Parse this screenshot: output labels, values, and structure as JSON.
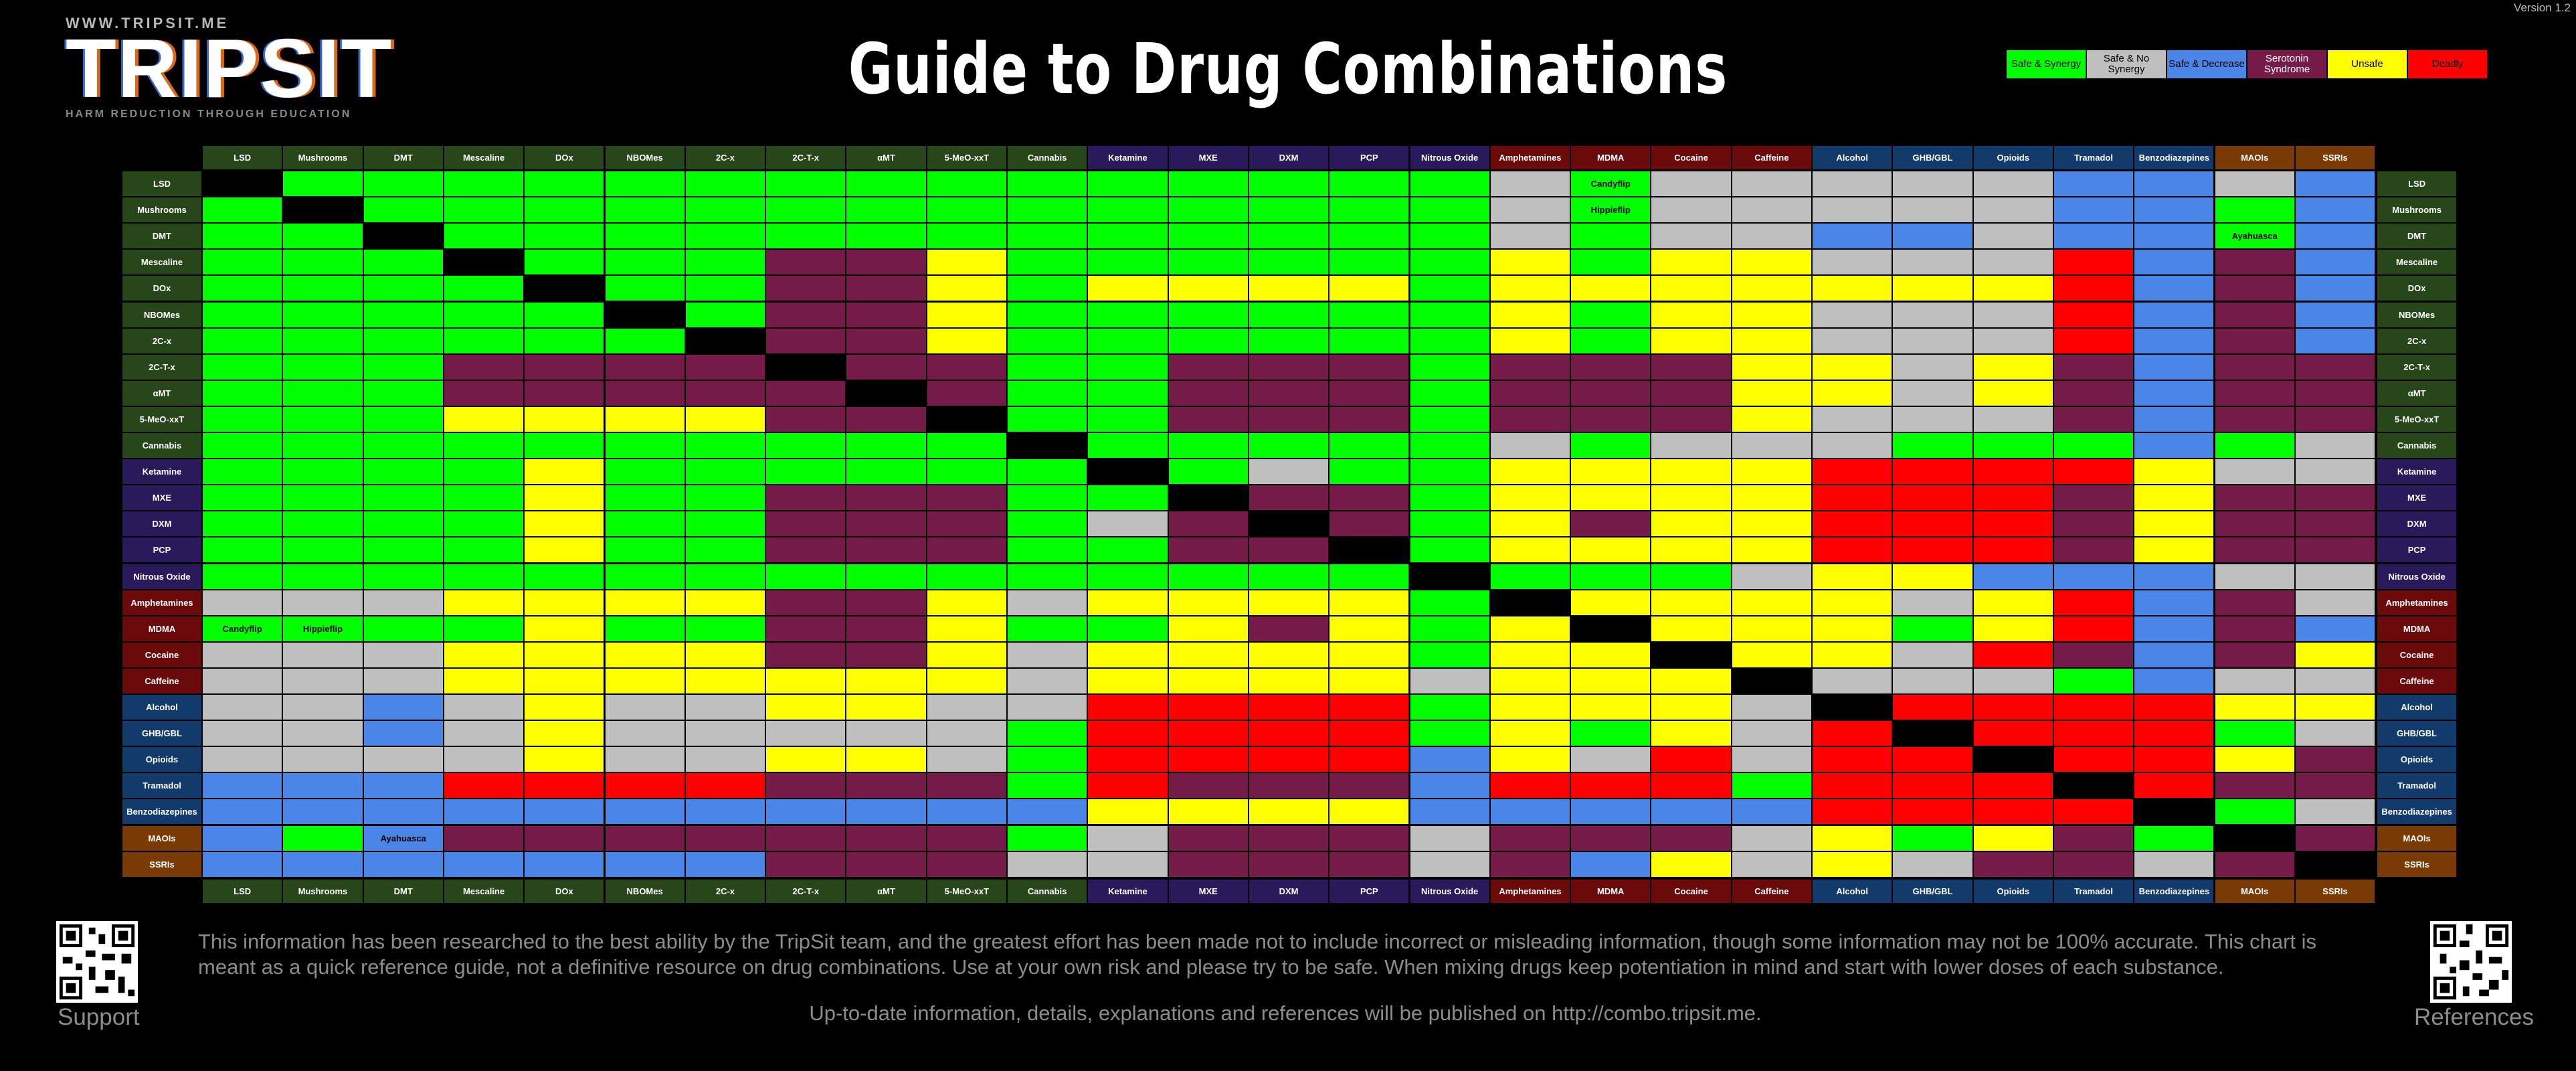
{
  "header": {
    "url": "WWW.TRIPSIT.ME",
    "logo_word": "TRIPSIT",
    "tagline": "HARM REDUCTION THROUGH EDUCATION",
    "title": "Guide to Drug Combinations",
    "version": "Version 1.2"
  },
  "legend": [
    {
      "label": "Safe & Synergy",
      "color": "#00ff00"
    },
    {
      "label": "Safe & No Synergy",
      "color": "#bfbfbf"
    },
    {
      "label": "Safe & Decrease",
      "color": "#4a86e8"
    },
    {
      "label": "Serotonin Syndrome",
      "color": "#741b47"
    },
    {
      "label": "Unsafe",
      "color": "#ffff00"
    },
    {
      "label": "Deadly",
      "color": "#ff0000"
    }
  ],
  "chart_data": {
    "type": "heatmap",
    "title": "Guide to Drug Combinations",
    "drugs": [
      "LSD",
      "Mushrooms",
      "DMT",
      "Mescaline",
      "DOx",
      "NBOMes",
      "2C-x",
      "2C-T-x",
      "αMT",
      "5-MeO-xxT",
      "Cannabis",
      "Ketamine",
      "MXE",
      "DXM",
      "PCP",
      "Nitrous Oxide",
      "Amphetamines",
      "MDMA",
      "Cocaine",
      "Caffeine",
      "Alcohol",
      "GHB/GBL",
      "Opioids",
      "Tramadol",
      "Benzodiazepines",
      "MAOIs",
      "SSRIs"
    ],
    "label_colors": [
      "#27461a",
      "#27461a",
      "#27461a",
      "#27461a",
      "#27461a",
      "#27461a",
      "#27461a",
      "#27461a",
      "#27461a",
      "#27461a",
      "#27461a",
      "#2a1a5c",
      "#2a1a5c",
      "#2a1a5c",
      "#2a1a5c",
      "#2a1a5c",
      "#6b0a0a",
      "#6b0a0a",
      "#6b0a0a",
      "#6b0a0a",
      "#123a6b",
      "#123a6b",
      "#123a6b",
      "#123a6b",
      "#123a6b",
      "#7a3a05",
      "#7a3a05"
    ],
    "categories": {
      "G": "Safe & Synergy",
      "S": "Safe & No Synergy",
      "B": "Safe & Decrease",
      "P": "Serotonin Syndrome",
      "Y": "Unsafe",
      "R": "Deadly",
      "K": "same substance"
    },
    "colors": {
      "G": "#00ff00",
      "S": "#bfbfbf",
      "B": "#4a86e8",
      "P": "#741b47",
      "Y": "#ffff00",
      "R": "#ff0000",
      "K": "#000000"
    },
    "matrix": [
      "KGGGGGGGGGGGGGGGSGSSSSSBBSB",
      "GKGGGGGGGGGGGGGGSGSSSSSBBGB",
      "GGKGGGGGGGGGGGGGSGSSBBSBBGB",
      "GGGKGGGPPYGGGGGGYGYYSSSRBPB",
      "GGGGKGGPPYGYYYYGYYYYYYYRBPB",
      "GGGGGKGPPYGGGGGGYGYYSSSRBPB",
      "GGGGGGKPPYGGGGGGYGYYSSSRBPB",
      "GGGPPPPKPPGGPPPGPPPYYSYPBPP",
      "GGGPPPPPKPGGPPPGPPPYYSYPBPP",
      "GGGYYYYPPKGGPPPGPPPYSSSPBPP",
      "GGGGGGGGGGKGGGGGSGSSSGGGBGS",
      "GGGGYGGGGGGKGSGGYYYYRRRRYSS",
      "GGGGYGGPPPGGKPPGYYYYRRRPYPP",
      "GGGGYGGPPPGSPKPGYPYYRRRPYPP",
      "GGGGYGGPPPGGPPKGYYYYRRRPYPP",
      "GGGGGGGGGGGGGGGKGGGSYYBBBSS",
      "SSSYYYYPPYSYYYYGKYYYYSYRBPS",
      "GGGGYGGPPYGGYPYGYKYYYGYRBPB",
      "SSSYYYYPPYSYYYYGYYKYYSRPBPY",
      "SSSYYYYYYYSYYYYSYYYKSSSGBSS",
      "SSBSYSSYYSSRRRRGYYYSKRRRRYY",
      "SSBSYSSSSSGRRRRGYGYSRKRRRGS",
      "SSSSYSSYYSGRRRRBYSRSRRKRRYP",
      "BBBRRRRPPPGRPPPBRRRGRRRKRPP",
      "BBBBBBBBBBBYYYYBBBBBRRRRKGS",
      "BGBPPPPPPPGSPPPSPPPSYGYPGKP",
      "BBBBBBBPPPSSPPPSPBYSYSPPSPK"
    ],
    "cell_notes": [
      {
        "row": 0,
        "col": 17,
        "text": "Candyflip"
      },
      {
        "row": 1,
        "col": 17,
        "text": "Hippieflip"
      },
      {
        "row": 17,
        "col": 0,
        "text": "Candyflip"
      },
      {
        "row": 17,
        "col": 1,
        "text": "Hippieflip"
      },
      {
        "row": 2,
        "col": 25,
        "text": "Ayahuasca"
      },
      {
        "row": 25,
        "col": 2,
        "text": "Ayahuasca"
      }
    ]
  },
  "footer": {
    "disclaimer": "This information has been researched to the best ability by the TripSit team, and the greatest effort has been made not to include incorrect or misleading information, though some information may not be 100% accurate. This chart is meant as a quick reference guide, not a definitive resource on drug combinations. Use at your own risk and please try to be safe. When mixing drugs keep potentiation in mind and start with lower doses of each substance.",
    "website": "Up-to-date information, details, explanations and references will be published on http://combo.tripsit.me.",
    "support_label": "Support",
    "references_label": "References"
  }
}
